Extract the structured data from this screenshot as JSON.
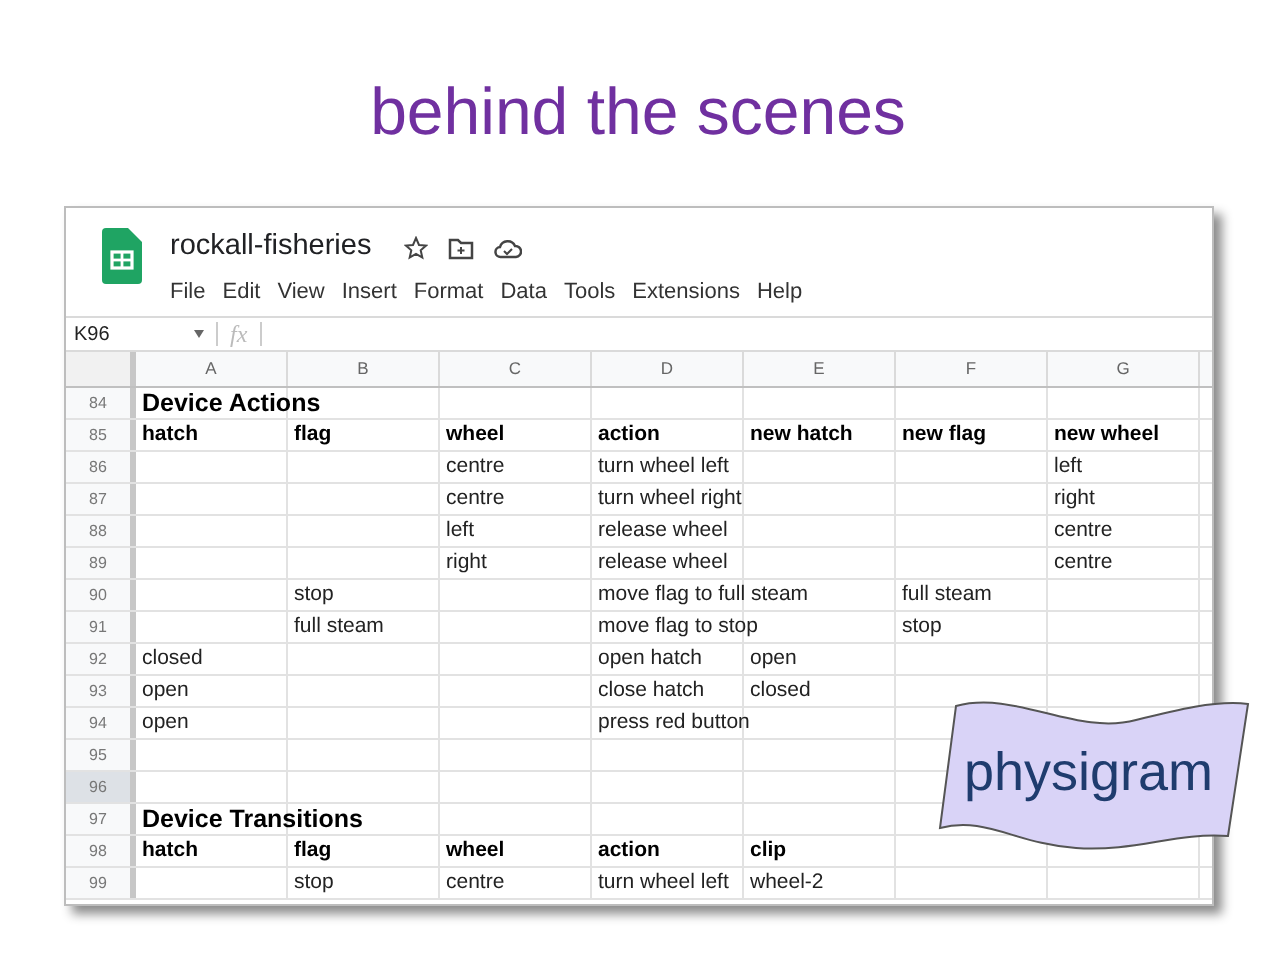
{
  "slide_title": "behind the scenes",
  "app": {
    "doc_title": "rockall-fisheries",
    "menu": [
      "File",
      "Edit",
      "View",
      "Insert",
      "Format",
      "Data",
      "Tools",
      "Extensions",
      "Help"
    ],
    "name_box": "K96",
    "formula_label": "fx"
  },
  "columns": [
    "A",
    "B",
    "C",
    "D",
    "E",
    "F",
    "G"
  ],
  "rows": [
    {
      "number": "84",
      "kind": "section",
      "selected": false,
      "cells": [
        "Device Actions",
        null,
        null,
        null,
        null,
        null,
        null
      ]
    },
    {
      "number": "85",
      "kind": "header",
      "selected": false,
      "cells": [
        "hatch",
        "flag",
        "wheel",
        "action",
        "new hatch",
        "new flag",
        "new wheel"
      ]
    },
    {
      "number": "86",
      "kind": "data",
      "selected": false,
      "cells": [
        null,
        null,
        "centre",
        "turn wheel left",
        null,
        null,
        "left"
      ]
    },
    {
      "number": "87",
      "kind": "data",
      "selected": false,
      "cells": [
        null,
        null,
        "centre",
        "turn wheel right",
        null,
        null,
        "right"
      ]
    },
    {
      "number": "88",
      "kind": "data",
      "selected": false,
      "cells": [
        null,
        null,
        "left",
        "release wheel",
        null,
        null,
        "centre"
      ]
    },
    {
      "number": "89",
      "kind": "data",
      "selected": false,
      "cells": [
        null,
        null,
        "right",
        "release wheel",
        null,
        null,
        "centre"
      ]
    },
    {
      "number": "90",
      "kind": "data",
      "selected": false,
      "cells": [
        null,
        "stop",
        null,
        "move flag to full steam",
        null,
        "full steam",
        null
      ]
    },
    {
      "number": "91",
      "kind": "data",
      "selected": false,
      "cells": [
        null,
        "full steam",
        null,
        "move flag to stop",
        null,
        "stop",
        null
      ]
    },
    {
      "number": "92",
      "kind": "data",
      "selected": false,
      "cells": [
        "closed",
        null,
        null,
        "open hatch",
        "open",
        null,
        null
      ]
    },
    {
      "number": "93",
      "kind": "data",
      "selected": false,
      "cells": [
        "open",
        null,
        null,
        "close hatch",
        "closed",
        null,
        null
      ]
    },
    {
      "number": "94",
      "kind": "data",
      "selected": false,
      "cells": [
        "open",
        null,
        null,
        "press red button",
        null,
        null,
        null
      ]
    },
    {
      "number": "95",
      "kind": "data",
      "selected": false,
      "cells": [
        null,
        null,
        null,
        null,
        null,
        null,
        null
      ]
    },
    {
      "number": "96",
      "kind": "data",
      "selected": true,
      "cells": [
        null,
        null,
        null,
        null,
        null,
        null,
        null
      ]
    },
    {
      "number": "97",
      "kind": "section",
      "selected": false,
      "cells": [
        "Device Transitions",
        null,
        null,
        null,
        null,
        null,
        null
      ]
    },
    {
      "number": "98",
      "kind": "header",
      "selected": false,
      "cells": [
        "hatch",
        "flag",
        "wheel",
        "action",
        "clip",
        null,
        null
      ]
    },
    {
      "number": "99",
      "kind": "data",
      "selected": false,
      "cells": [
        null,
        "stop",
        "centre",
        "turn wheel left",
        "wheel-2",
        null,
        null
      ]
    }
  ],
  "callout": {
    "text": "physigram"
  }
}
